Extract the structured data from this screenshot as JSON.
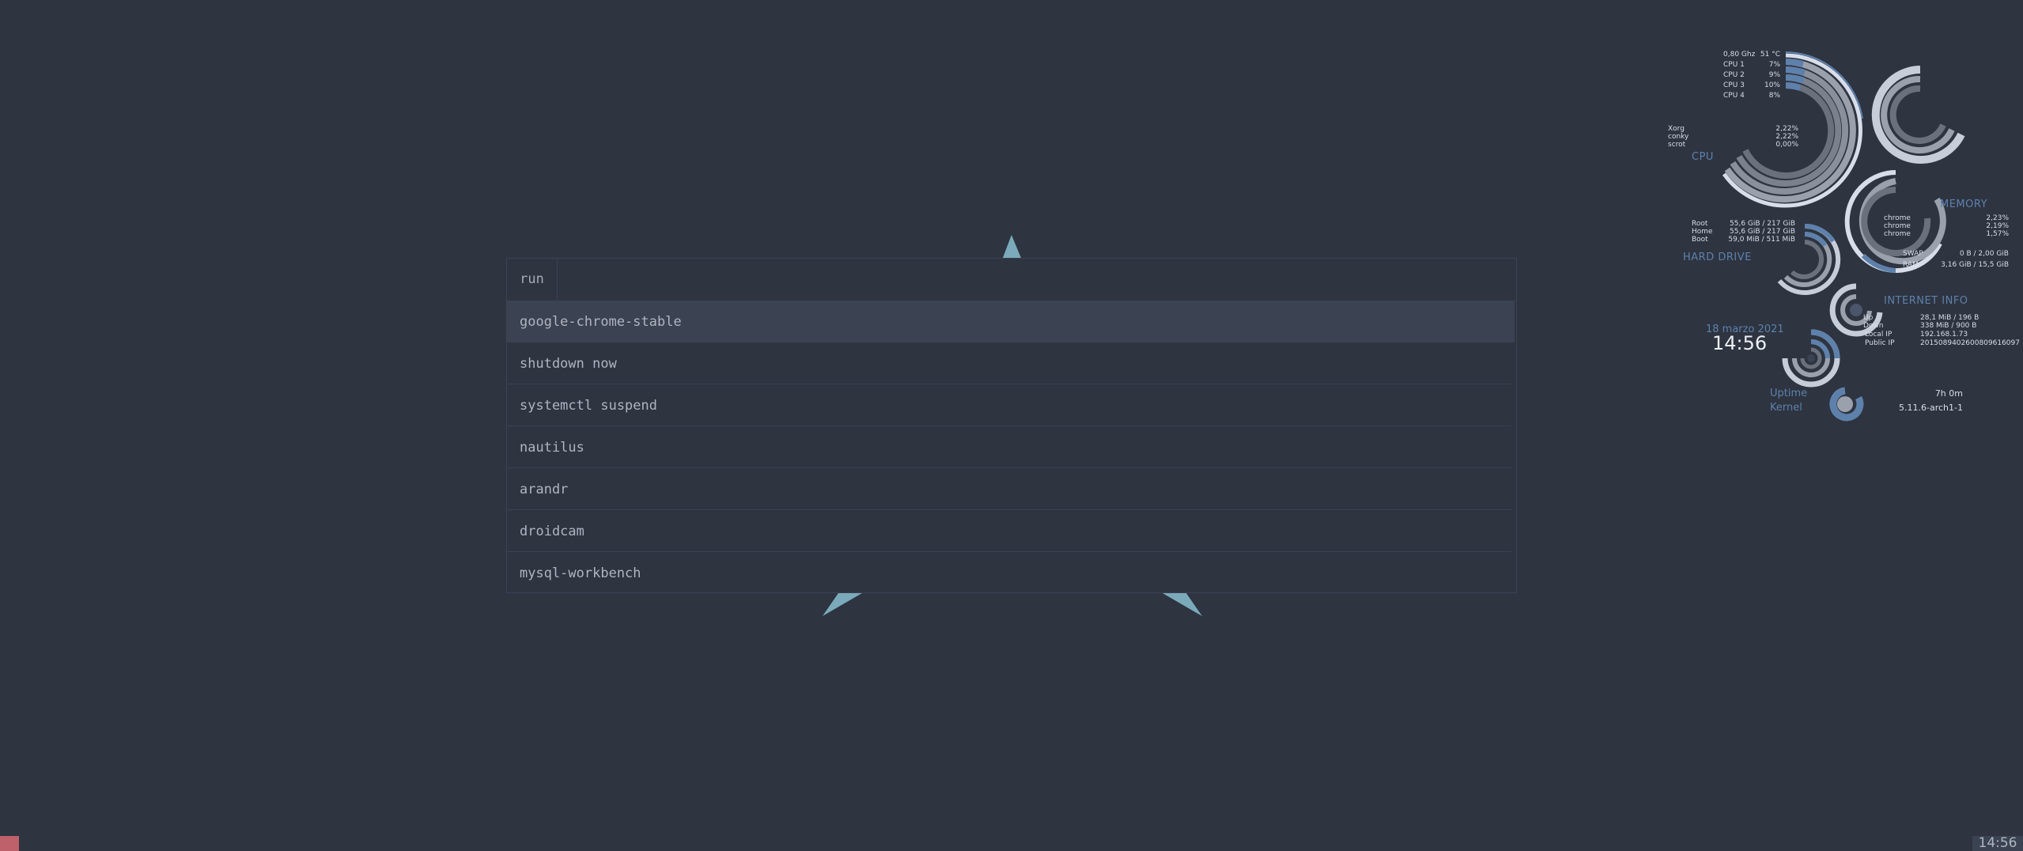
{
  "rofi": {
    "prompt": "run",
    "input_value": "",
    "items": [
      {
        "label": "google-chrome-stable",
        "selected": true
      },
      {
        "label": "shutdown now"
      },
      {
        "label": "systemctl suspend"
      },
      {
        "label": "nautilus"
      },
      {
        "label": "arandr"
      },
      {
        "label": "droidcam"
      },
      {
        "label": "mysql-workbench"
      }
    ]
  },
  "conky": {
    "cpu": {
      "heading": "CPU",
      "freq": "0,80 Ghz",
      "temp": "51 °C",
      "cores": [
        {
          "label": "CPU 1",
          "value": "7%"
        },
        {
          "label": "CPU 2",
          "value": "9%"
        },
        {
          "label": "CPU 3",
          "value": "10%"
        },
        {
          "label": "CPU 4",
          "value": "8%"
        }
      ],
      "processes": [
        {
          "name": "Xorg",
          "value": "2,22%"
        },
        {
          "name": "conky",
          "value": "2,22%"
        },
        {
          "name": "scrot",
          "value": "0,00%"
        }
      ]
    },
    "memory": {
      "heading": "MEMORY",
      "processes": [
        {
          "name": "chrome",
          "value": "2,23%"
        },
        {
          "name": "chrome",
          "value": "2,19%"
        },
        {
          "name": "chrome",
          "value": "1,57%"
        }
      ],
      "swap_label": "SWAP",
      "swap_value": "0 B / 2,00 GiB",
      "ram_label": "RAM",
      "ram_value": "3,16 GiB / 15,5 GiB"
    },
    "hard_drive": {
      "heading": "HARD  DRIVE",
      "partitions": [
        {
          "name": "Root",
          "value": "55,6 GiB / 217 GiB"
        },
        {
          "name": "Home",
          "value": "55,6 GiB / 217 GiB"
        },
        {
          "name": "Boot",
          "value": "59,0 MiB / 511 MiB"
        }
      ]
    },
    "internet": {
      "heading": "INTERNET  INFO",
      "rows": [
        {
          "name": "Up",
          "value": "28,1 MiB / 196 B"
        },
        {
          "name": "Down",
          "value": "338 MiB / 900 B"
        },
        {
          "name": "Local IP",
          "value": "192.168.1.73"
        },
        {
          "name": "Public IP",
          "value": "2015089402600809616097"
        }
      ]
    },
    "clock": {
      "date": "18 marzo 2021",
      "time": "14:56"
    },
    "system": {
      "uptime_label": "Uptime",
      "uptime_value": "7h 0m",
      "kernel_label": "Kernel",
      "kernel_value": "5.11.6-arch1-1"
    },
    "colors": {
      "accent": "#5e81ac",
      "ring_light": "#d8dee9",
      "ring_mid": "#9aa1ac",
      "ring_dark": "#6b717c"
    }
  },
  "bar": {
    "clock": "14:56",
    "workspace_color": "#bf616a"
  }
}
